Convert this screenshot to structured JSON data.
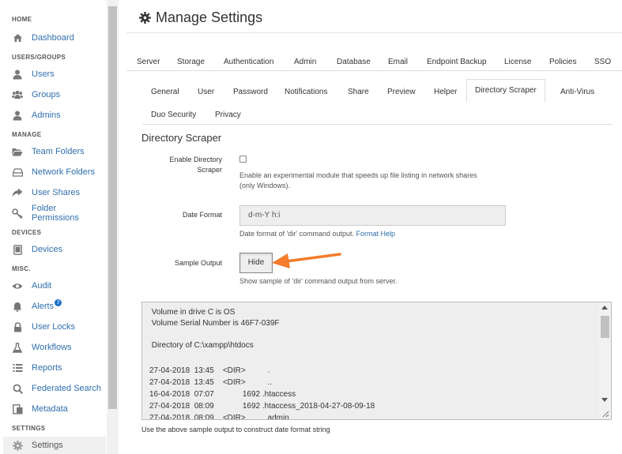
{
  "sidebar": {
    "sections": {
      "home": "HOME",
      "users_groups": "USERS/GROUPS",
      "manage": "MANAGE",
      "devices": "DEVICES",
      "misc": "MISC.",
      "settings": "SETTINGS"
    },
    "items": {
      "dashboard": "Dashboard",
      "users": "Users",
      "groups": "Groups",
      "admins": "Admins",
      "team_folders": "Team Folders",
      "network_folders": "Network Folders",
      "user_shares": "User Shares",
      "folder_permissions": "Folder Permissions",
      "devices": "Devices",
      "audit": "Audit",
      "alerts": "Alerts",
      "alerts_badge": "!",
      "user_locks": "User Locks",
      "workflows": "Workflows",
      "reports": "Reports",
      "federated_search": "Federated Search",
      "metadata": "Metadata",
      "settings": "Settings"
    }
  },
  "page": {
    "title": "Manage Settings"
  },
  "tabs_primary": [
    "Server",
    "Storage",
    "Authentication",
    "Admin",
    "Database",
    "Email",
    "Endpoint Backup",
    "License",
    "Policies",
    "SSO"
  ],
  "tabs_secondary": [
    "General",
    "User",
    "Password",
    "Notifications",
    "Share",
    "Preview",
    "Helper",
    "Directory Scraper",
    "Anti-Virus",
    "Duo Security",
    "Privacy"
  ],
  "section": {
    "title": "Directory Scraper"
  },
  "enable": {
    "label_line1": "Enable Directory",
    "label_line2": "Scraper",
    "help_line1": "Enable an experimental module that speeds up file listing in network shares",
    "help_line2": "(only Windows)."
  },
  "date_format": {
    "label": "Date Format",
    "value": "d-m-Y h:i",
    "help": "Date format of 'dir' command output.",
    "help_link": "Format Help"
  },
  "sample_output": {
    "label": "Sample Output",
    "button": "Hide",
    "help": "Show sample of 'dir' command output from server."
  },
  "output_lines": [
    " Volume in drive C is OS",
    " Volume Serial Number is 46F7-039F",
    "",
    " Directory of C:\\xampp\\htdocs",
    "",
    "27-04-2018  13:45    <DIR>          .",
    "27-04-2018  13:45    <DIR>          ..",
    "16-04-2018  07:07             1692 .htaccess",
    "27-04-2018  08:09             1692 .htaccess_2018-04-27-08-09-18",
    "27-04-2018  08:09    <DIR>          admin"
  ],
  "footer_help": "Use the above sample output to construct date format string",
  "colors": {
    "link": "#2f6fad",
    "arrow": "#f47c2c",
    "badge": "#1f6fc9"
  }
}
